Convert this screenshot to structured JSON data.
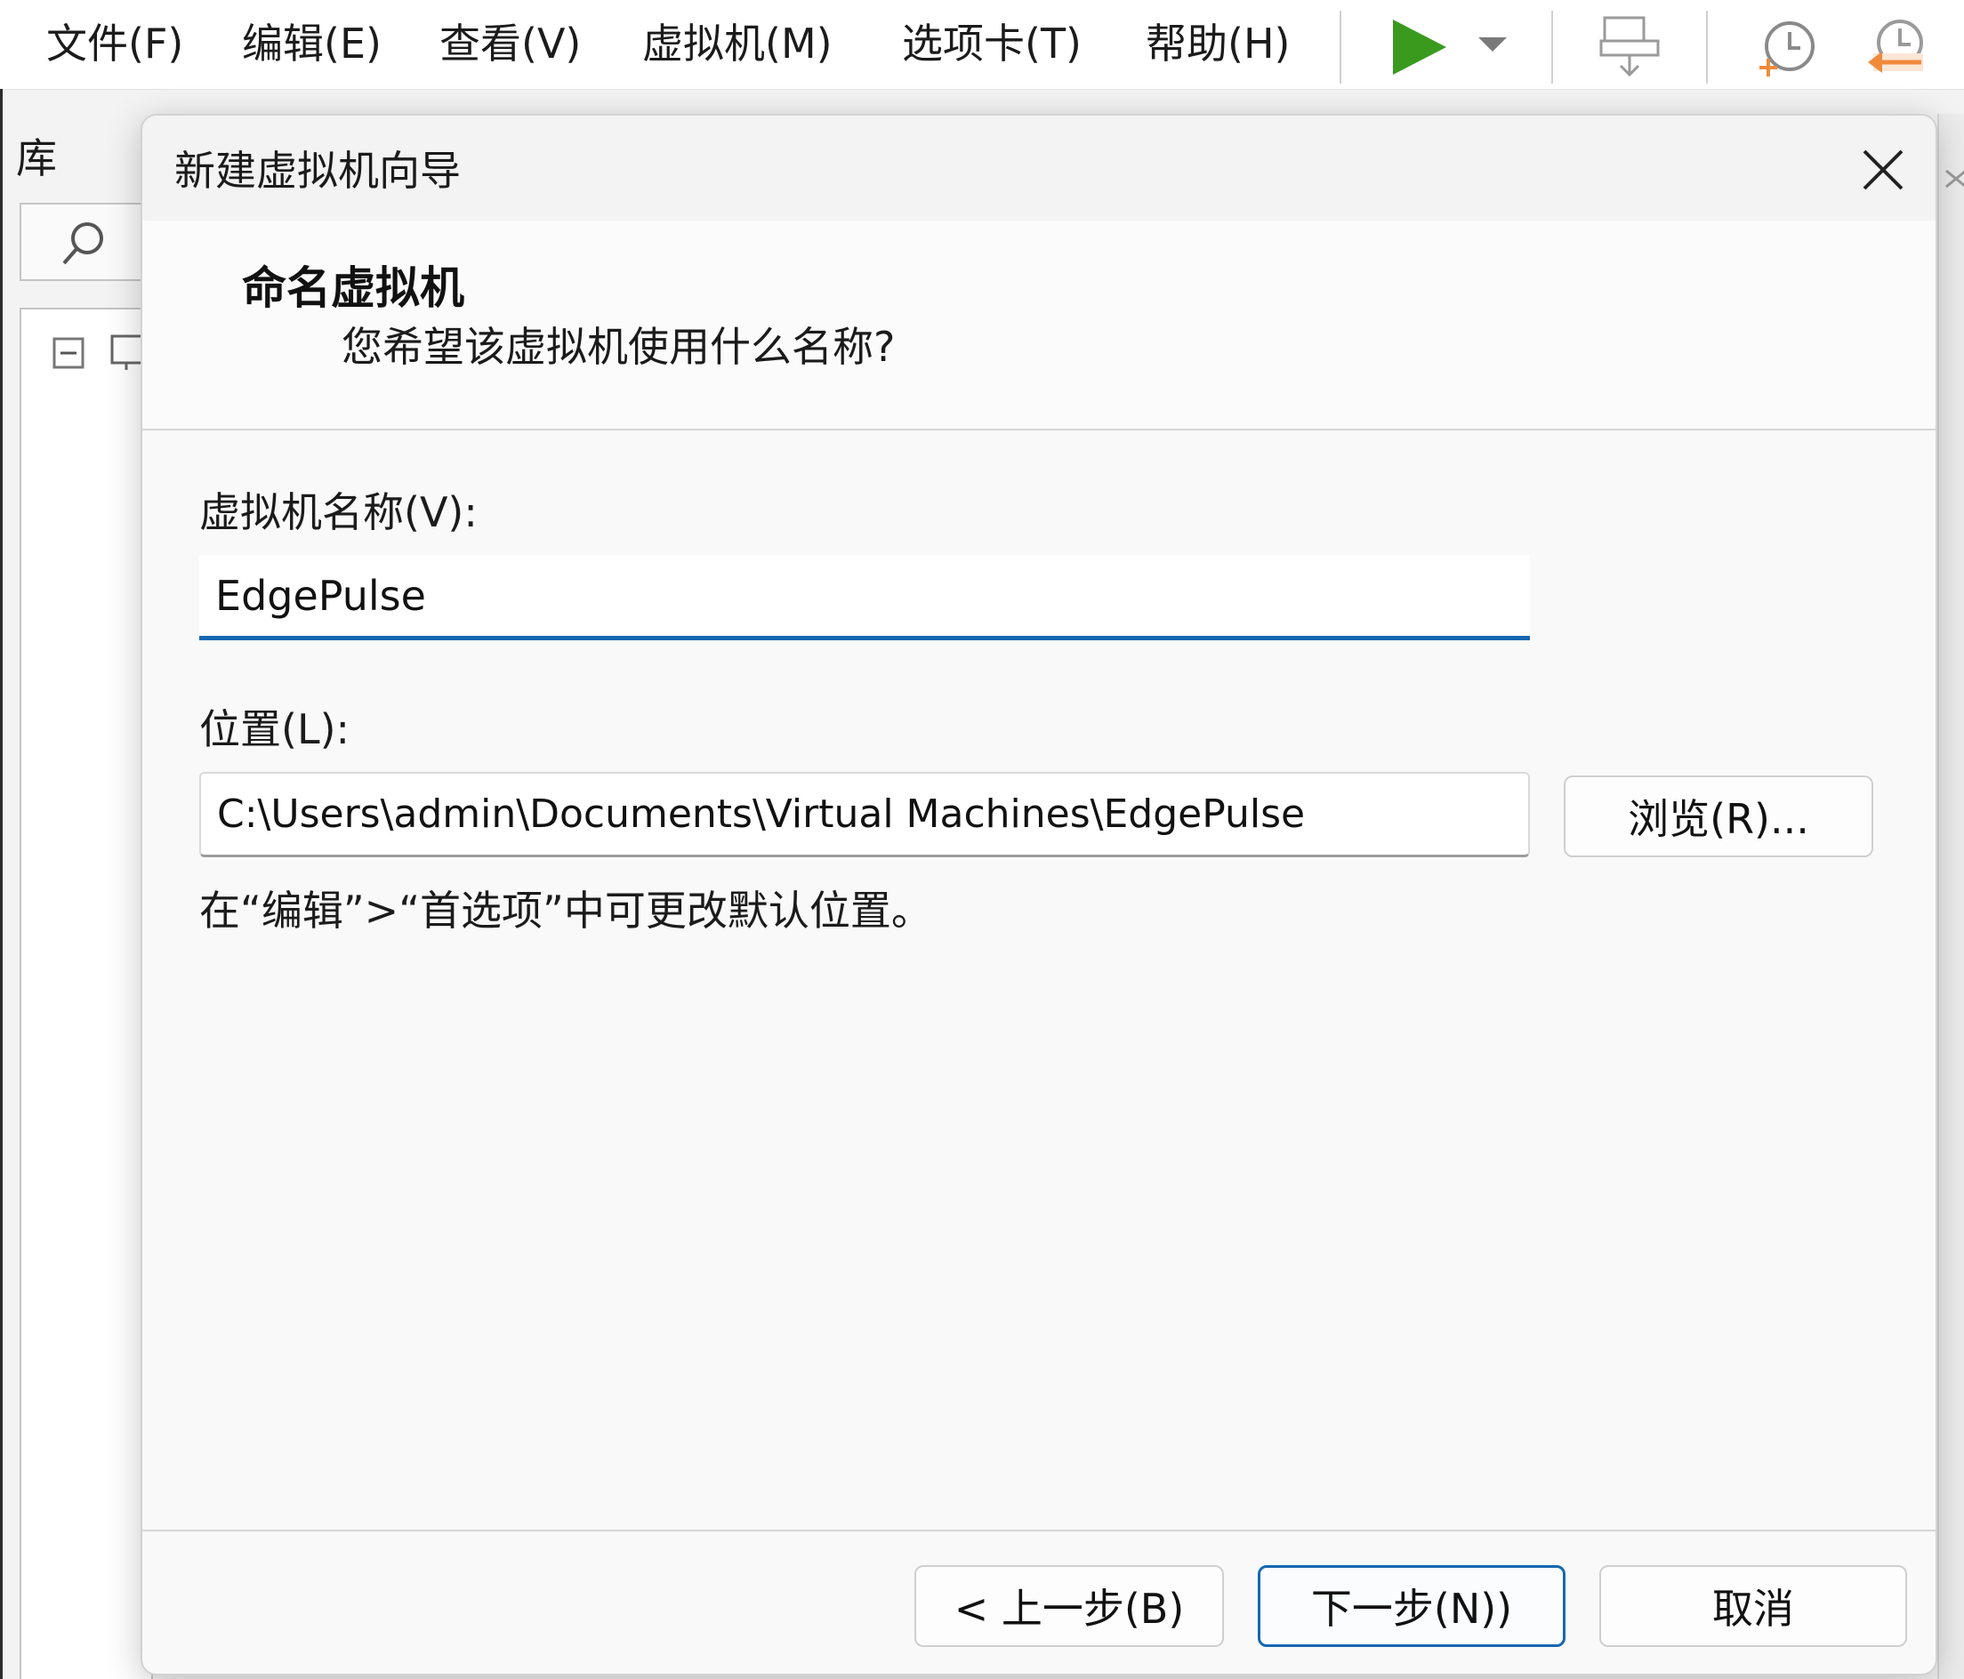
{
  "menubar": {
    "items": [
      "文件(F)",
      "编辑(E)",
      "查看(V)",
      "虚拟机(M)",
      "选项卡(T)",
      "帮助(H)"
    ]
  },
  "toolbar": {
    "icons": [
      "play-icon",
      "chevron-down-icon",
      "send-keys-icon",
      "snapshot-icon",
      "revert-snapshot-icon"
    ],
    "colors": {
      "play": "#3a9a1e",
      "revert": "#f08a3c"
    }
  },
  "library": {
    "title": "库"
  },
  "dialog": {
    "title": "新建虚拟机向导",
    "header_title": "命名虚拟机",
    "header_subtitle": "您希望该虚拟机使用什么名称?",
    "name_label": "虚拟机名称(V):",
    "name_value": "EdgePulse",
    "location_label": "位置(L):",
    "location_value": "C:\\Users\\admin\\Documents\\Virtual Machines\\EdgePulse",
    "browse_label": "浏览(R)...",
    "hint": "在“编辑”>“首选项”中可更改默认位置。",
    "back_label": "< 上一步(B)",
    "next_label": "下一步(N))",
    "cancel_label": "取消",
    "accent": "#1567b0"
  }
}
